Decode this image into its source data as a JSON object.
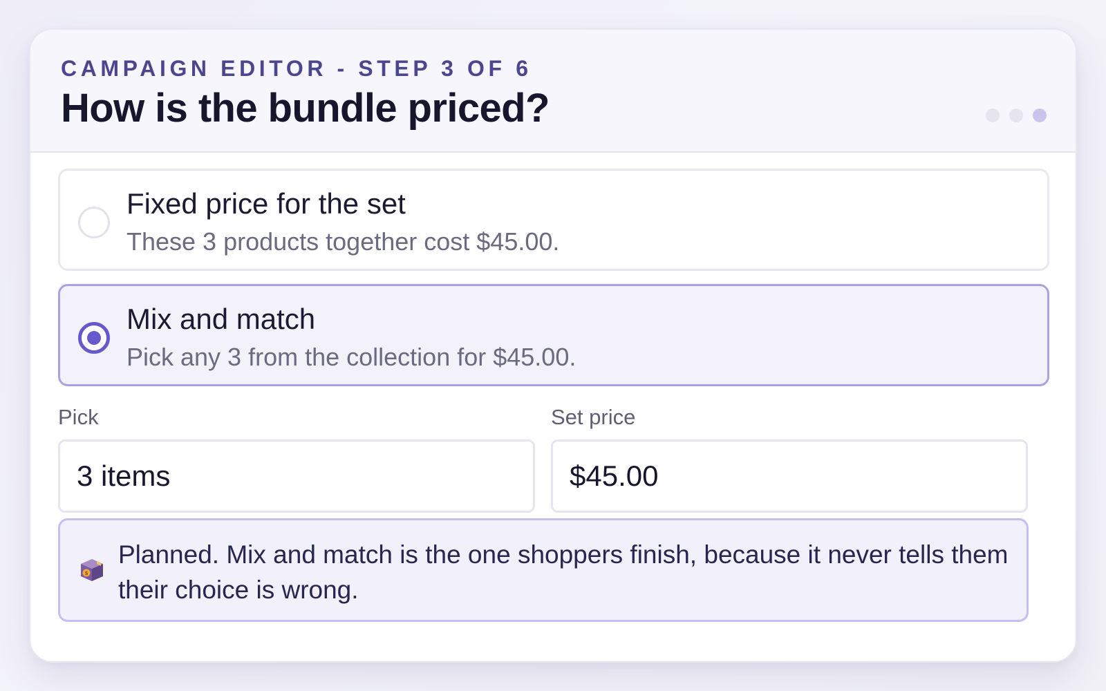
{
  "header": {
    "eyebrow": "CAMPAIGN EDITOR - STEP 3 OF 6",
    "title": "How is the bundle priced?"
  },
  "options": [
    {
      "title": "Fixed price for the set",
      "description": "These 3 products together cost $45.00.",
      "selected": false
    },
    {
      "title": "Mix and match",
      "description": "Pick any 3 from the collection for $45.00.",
      "selected": true
    }
  ],
  "fields": {
    "pick": {
      "label": "Pick",
      "value": "3 items"
    },
    "price": {
      "label": "Set price",
      "value": "$45.00"
    }
  },
  "note": {
    "icon": "money-box-icon",
    "text": "Planned. Mix and match is the one shoppers finish, because it never tells them their choice is wrong."
  },
  "colors": {
    "accent": "#6659cc",
    "eyebrow": "#4c468e",
    "selected_border": "#a9a2e0",
    "note_background": "#f1f0fb"
  }
}
